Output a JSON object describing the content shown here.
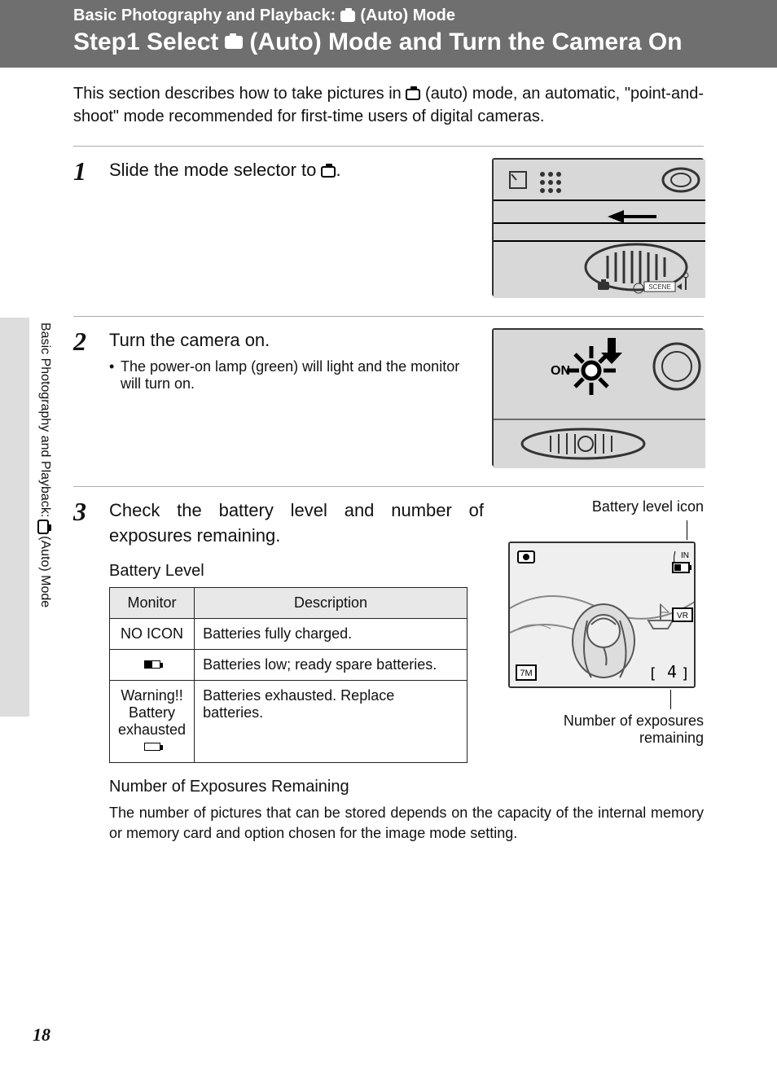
{
  "header": {
    "breadcrumb_prefix": "Basic Photography and Playback: ",
    "breadcrumb_suffix": " (Auto) Mode",
    "title_prefix": "Step1 Select ",
    "title_suffix": " (Auto) Mode and Turn the Camera On"
  },
  "intro": {
    "part1": "This section describes how to take pictures in ",
    "part2": " (auto) mode, an automatic, \"point-and-shoot\" mode recommended for first-time users of digital cameras."
  },
  "steps": {
    "s1": {
      "num": "1",
      "text_prefix": "Slide the mode selector to ",
      "text_suffix": "."
    },
    "s2": {
      "num": "2",
      "title": "Turn the camera on.",
      "bullet": "The power-on lamp (green) will light and the monitor will turn on.",
      "illus_on_label": "ON"
    },
    "s3": {
      "num": "3",
      "title": "Check the battery level and number of exposures remaining.",
      "battery_heading": "Battery Level",
      "table": {
        "headers": {
          "monitor": "Monitor",
          "description": "Description"
        },
        "rows": [
          {
            "monitor": "NO ICON",
            "monitor_type": "text",
            "description": "Batteries fully charged."
          },
          {
            "monitor": "half-battery",
            "monitor_type": "icon",
            "description": "Batteries low; ready spare batteries."
          },
          {
            "monitor": "Warning!!\nBattery\nexhausted",
            "monitor_type": "warning",
            "description": "Batteries exhausted. Replace batteries."
          }
        ]
      },
      "label_battery_icon": "Battery level icon",
      "lcd": {
        "mode_icon": "auto-camera",
        "in_label": "IN",
        "size_label": "7M",
        "remaining": "4"
      },
      "caption_remaining_l1": "Number of exposures",
      "caption_remaining_l2": "remaining",
      "exposures_heading": "Number of Exposures Remaining",
      "exposures_body": "The number of pictures that can be stored depends on the capacity of the internal memory or memory card and option chosen for the image mode setting."
    }
  },
  "side_tab": {
    "text_prefix": "Basic Photography and Playback: ",
    "text_suffix": " (Auto) Mode"
  },
  "page_number": "18"
}
